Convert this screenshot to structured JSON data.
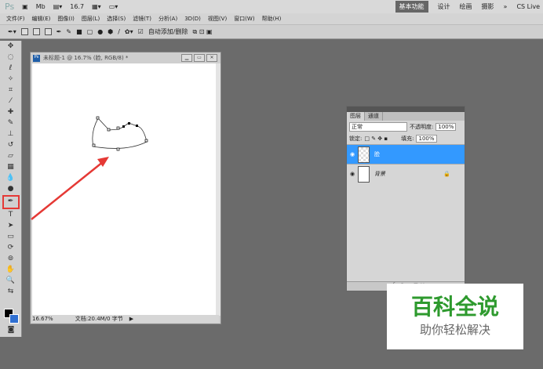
{
  "app": {
    "logo": "Ps",
    "zoom": "16.7",
    "workspaces": [
      "基本功能",
      "设计",
      "绘画",
      "摄影"
    ],
    "more": "»",
    "cslive": "CS Live"
  },
  "menu": [
    "文件(F)",
    "编辑(E)",
    "图像(I)",
    "图层(L)",
    "选择(S)",
    "滤镜(T)",
    "分析(A)",
    "3D(D)",
    "视图(V)",
    "窗口(W)",
    "帮助(H)"
  ],
  "options": {
    "auto_add_delete": "自动添加/删除"
  },
  "document": {
    "title": "未标题-1 @ 16.7% (脸, RGB/8) *",
    "zoom": "16.67%",
    "info": "文档:20.4M/0 字节"
  },
  "layers_panel": {
    "tabs": [
      "图层",
      "通道"
    ],
    "blend_mode": "正常",
    "opacity_label": "不透明度:",
    "opacity": "100%",
    "lock_label": "锁定:",
    "fill_label": "填充:",
    "fill": "100%",
    "layers": [
      {
        "name": "脸",
        "selected": true
      },
      {
        "name": "背景",
        "selected": false
      }
    ]
  },
  "watermark": {
    "title": "百科全说",
    "subtitle": "助你轻松解决"
  },
  "colors": {
    "accent": "#3399ff",
    "highlight": "#e53935"
  }
}
